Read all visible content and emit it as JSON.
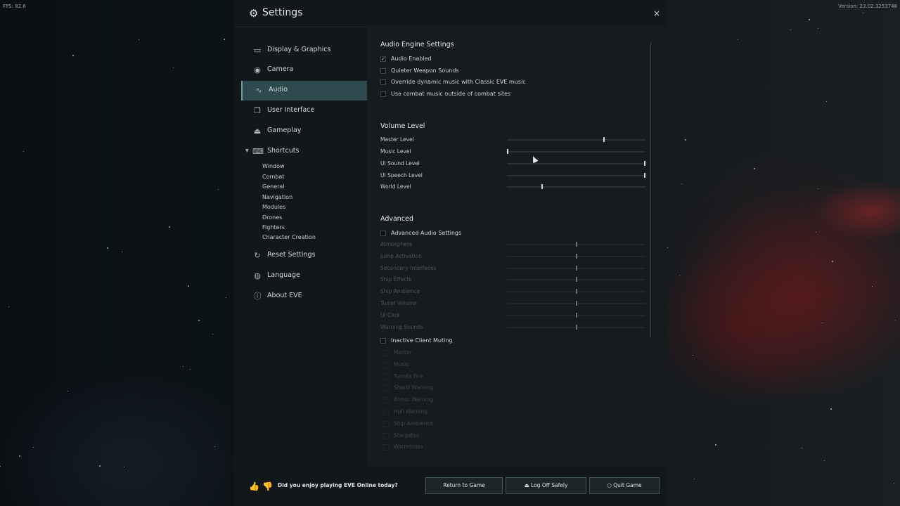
{
  "hud": {
    "fps": "FPS: 82.6",
    "version": "Version: 23.02.3253748"
  },
  "window": {
    "title": "Settings",
    "close_label": "×"
  },
  "nav": {
    "items": [
      {
        "label": "Display & Graphics",
        "icon": "monitor-icon"
      },
      {
        "label": "Camera",
        "icon": "eye-icon"
      },
      {
        "label": "Audio",
        "icon": "audio-icon",
        "active": true
      },
      {
        "label": "User Interface",
        "icon": "window-icon"
      },
      {
        "label": "Gameplay",
        "icon": "joystick-icon"
      },
      {
        "label": "Shortcuts",
        "icon": "keyboard-icon"
      }
    ],
    "shortcuts_sub": [
      "Window",
      "Combat",
      "General",
      "Navigation",
      "Modules",
      "Drones",
      "Fighters",
      "Character Creation"
    ],
    "bottom_items": [
      {
        "label": "Reset Settings",
        "icon": "reset-icon"
      },
      {
        "label": "Language",
        "icon": "globe-icon"
      },
      {
        "label": "About EVE",
        "icon": "info-icon"
      }
    ]
  },
  "audio_engine": {
    "title": "Audio Engine Settings",
    "options": [
      {
        "label": "Audio Enabled",
        "checked": true
      },
      {
        "label": "Quieter Weapon Sounds",
        "checked": false
      },
      {
        "label": "Override dynamic music with Classic EVE music",
        "checked": false
      },
      {
        "label": "Use combat music outside of combat sites",
        "checked": false
      }
    ]
  },
  "volume": {
    "title": "Volume Level",
    "levels": [
      {
        "label": "Master Level",
        "value": 0.7
      },
      {
        "label": "Music Level",
        "value": 0.0
      },
      {
        "label": "UI Sound Level",
        "value": 1.0
      },
      {
        "label": "UI Speech Level",
        "value": 1.0
      },
      {
        "label": "World Level",
        "value": 0.25
      }
    ]
  },
  "advanced": {
    "title": "Advanced",
    "toggle_label": "Advanced Audio Settings",
    "levels": [
      {
        "label": "Atmosphere",
        "value": 0.5
      },
      {
        "label": "Jump Activation",
        "value": 0.5
      },
      {
        "label": "Secondary Interfaces",
        "value": 0.5
      },
      {
        "label": "Ship Effects",
        "value": 0.5
      },
      {
        "label": "Ship Ambience",
        "value": 0.5
      },
      {
        "label": "Turret Volume",
        "value": 0.5
      },
      {
        "label": "UI Click",
        "value": 0.5
      },
      {
        "label": "Warning Sounds",
        "value": 0.5
      }
    ],
    "muting_label": "Inactive Client Muting",
    "muting_items": [
      "Master",
      "Music",
      "Turrets Fire",
      "Shield Warning",
      "Armor Warning",
      "Hull Warning",
      "Ship Ambience",
      "Stargates",
      "Wormholes"
    ]
  },
  "footer": {
    "feedback": "Did you enjoy playing EVE Online today?",
    "return_label": "Return to Game",
    "logoff_label": "Log Off Safely",
    "quit_label": "Quit Game"
  }
}
